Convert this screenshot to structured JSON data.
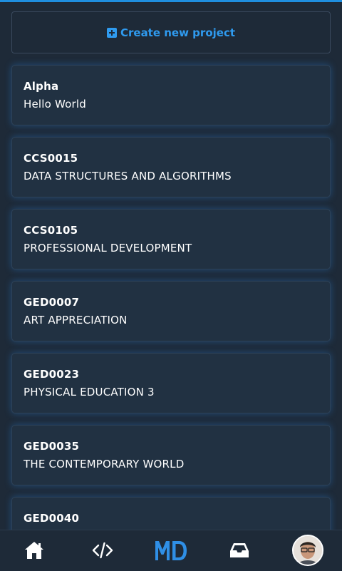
{
  "header": {
    "accent_color": "#1f8fe0"
  },
  "create_project": {
    "label": "Create new project",
    "icon": "plus-square-icon"
  },
  "projects": [
    {
      "code": "Alpha",
      "name": "Hello World"
    },
    {
      "code": "CCS0015",
      "name": "DATA STRUCTURES AND ALGORITHMS"
    },
    {
      "code": "CCS0105",
      "name": "PROFESSIONAL DEVELOPMENT"
    },
    {
      "code": "GED0007",
      "name": "ART APPRECIATION"
    },
    {
      "code": "GED0023",
      "name": "PHYSICAL EDUCATION 3"
    },
    {
      "code": "GED0035",
      "name": "THE CONTEMPORARY WORLD"
    },
    {
      "code": "GED0040",
      "name": ""
    }
  ],
  "bottom_nav": {
    "items": [
      {
        "icon": "home-icon"
      },
      {
        "icon": "code-icon"
      },
      {
        "icon": "md-logo",
        "label": "MD"
      },
      {
        "icon": "inbox-icon"
      },
      {
        "icon": "user-avatar"
      }
    ],
    "logo_color": "#2f8fe6"
  }
}
